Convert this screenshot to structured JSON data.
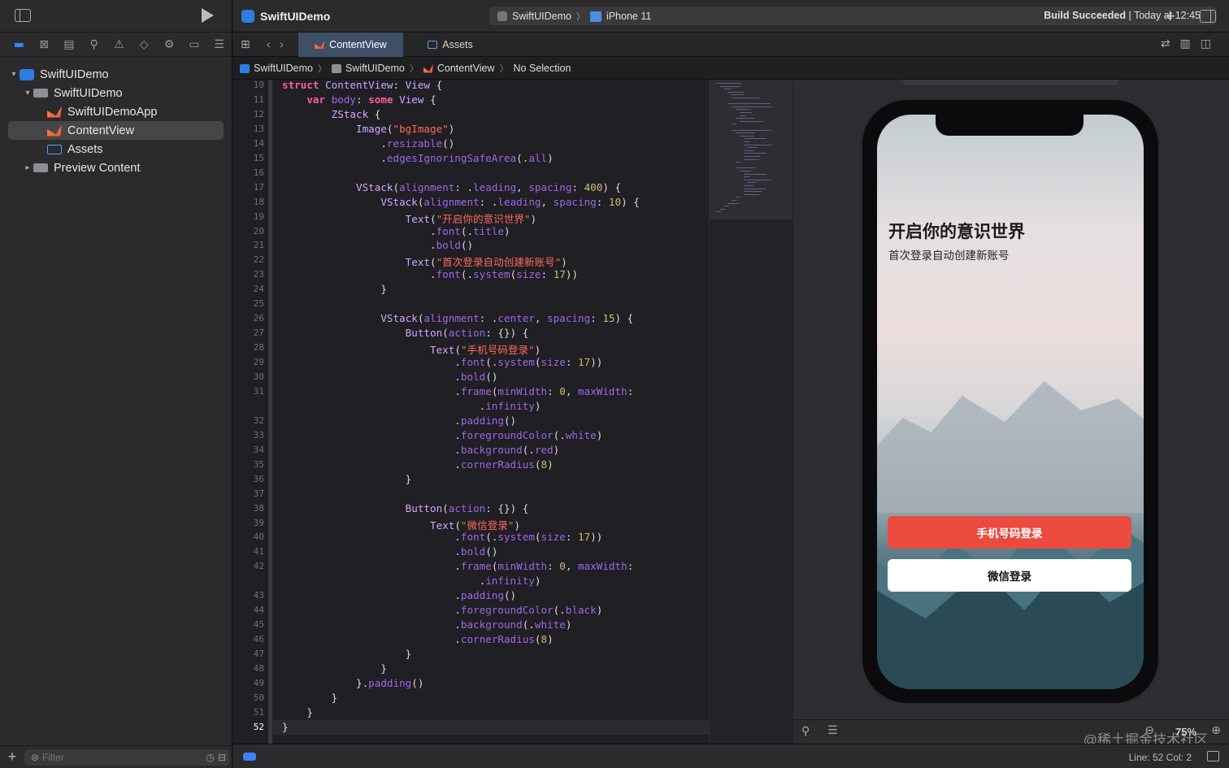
{
  "navigator": {
    "tree": [
      {
        "label": "SwiftUIDemo",
        "kind": "project",
        "disclosure": "open",
        "depth": 0
      },
      {
        "label": "SwiftUIDemo",
        "kind": "folder",
        "disclosure": "open",
        "depth": 1
      },
      {
        "label": "SwiftUIDemoApp",
        "kind": "swift",
        "disclosure": "",
        "depth": 2
      },
      {
        "label": "ContentView",
        "kind": "swift",
        "disclosure": "",
        "depth": 2,
        "selected": true
      },
      {
        "label": "Assets",
        "kind": "assets",
        "disclosure": "",
        "depth": 2
      },
      {
        "label": "Preview Content",
        "kind": "folder",
        "disclosure": "closed",
        "depth": 1
      }
    ],
    "filter_placeholder": "Filter"
  },
  "toolbar": {
    "project_title": "SwiftUIDemo",
    "scheme": "SwiftUIDemo",
    "device": "iPhone 11",
    "build_status_bold": "Build Succeeded",
    "build_status_time": "| Today at 12:45",
    "add_label": "+"
  },
  "tabs": [
    {
      "label": "ContentView",
      "active": true
    },
    {
      "label": "Assets",
      "active": false
    }
  ],
  "jumpbar": {
    "crumbs": [
      "SwiftUIDemo",
      "SwiftUIDemo",
      "ContentView",
      "No Selection"
    ]
  },
  "editor": {
    "current_line": 52,
    "lines": [
      {
        "n": "10",
        "html": "<span class='kw'>struct</span> <span class='ty'>ContentView</span>: <span class='ty'>View</span> {"
      },
      {
        "n": "11",
        "html": "    <span class='kw'>var</span> <span class='fn'>body</span>: <span class='kw'>some</span> <span class='ty'>View</span> {"
      },
      {
        "n": "12",
        "html": "        <span class='ty'>ZStack</span> {"
      },
      {
        "n": "13",
        "html": "            <span class='ty'>Image</span>(<span class='st'>\"bgImage\"</span>)"
      },
      {
        "n": "14",
        "html": "                .<span class='pr'>resizable</span>()"
      },
      {
        "n": "15",
        "html": "                .<span class='pr'>edgesIgnoringSafeArea</span>(.<span class='pr'>all</span>)"
      },
      {
        "n": "16",
        "html": ""
      },
      {
        "n": "17",
        "html": "            <span class='ty'>VStack</span>(<span class='pr'>alignment</span>: .<span class='pr'>leading</span>, <span class='pr'>spacing</span>: <span class='nu'>400</span>) {"
      },
      {
        "n": "18",
        "html": "                <span class='ty'>VStack</span>(<span class='pr'>alignment</span>: .<span class='pr'>leading</span>, <span class='pr'>spacing</span>: <span class='nu'>10</span>) {"
      },
      {
        "n": "19",
        "html": "                    <span class='ty'>Text</span>(<span class='st'>\"开启你的意识世界\"</span>)"
      },
      {
        "n": "20",
        "html": "                        .<span class='pr'>font</span>(.<span class='pr'>title</span>)"
      },
      {
        "n": "21",
        "html": "                        .<span class='pr'>bold</span>()"
      },
      {
        "n": "22",
        "html": "                    <span class='ty'>Text</span>(<span class='st'>\"首次登录自动创建新账号\"</span>)"
      },
      {
        "n": "23",
        "html": "                        .<span class='pr'>font</span>(.<span class='pr'>system</span>(<span class='pr'>size</span>: <span class='nu'>17</span>))"
      },
      {
        "n": "24",
        "html": "                }"
      },
      {
        "n": "25",
        "html": ""
      },
      {
        "n": "26",
        "html": "                <span class='ty'>VStack</span>(<span class='pr'>alignment</span>: .<span class='pr'>center</span>, <span class='pr'>spacing</span>: <span class='nu'>15</span>) {"
      },
      {
        "n": "27",
        "html": "                    <span class='ty'>Button</span>(<span class='pr'>action</span>: {}) {"
      },
      {
        "n": "28",
        "html": "                        <span class='ty'>Text</span>(<span class='st'>\"手机号码登录\"</span>)"
      },
      {
        "n": "29",
        "html": "                            .<span class='pr'>font</span>(.<span class='pr'>system</span>(<span class='pr'>size</span>: <span class='nu'>17</span>))"
      },
      {
        "n": "30",
        "html": "                            .<span class='pr'>bold</span>()"
      },
      {
        "n": "31",
        "html": "                            .<span class='pr'>frame</span>(<span class='pr'>minWidth</span>: <span class='nu'>0</span>, <span class='pr'>maxWidth</span>:"
      },
      {
        "n": "",
        "html": "                                .<span class='pr'>infinity</span>)"
      },
      {
        "n": "32",
        "html": "                            .<span class='pr'>padding</span>()"
      },
      {
        "n": "33",
        "html": "                            .<span class='pr'>foregroundColor</span>(.<span class='pr'>white</span>)"
      },
      {
        "n": "34",
        "html": "                            .<span class='pr'>background</span>(.<span class='pr'>red</span>)"
      },
      {
        "n": "35",
        "html": "                            .<span class='pr'>cornerRadius</span>(<span class='nu'>8</span>)"
      },
      {
        "n": "36",
        "html": "                    }"
      },
      {
        "n": "37",
        "html": ""
      },
      {
        "n": "38",
        "html": "                    <span class='ty'>Button</span>(<span class='pr'>action</span>: {}) {"
      },
      {
        "n": "39",
        "html": "                        <span class='ty'>Text</span>(<span class='st'>\"微信登录\"</span>)"
      },
      {
        "n": "40",
        "html": "                            .<span class='pr'>font</span>(.<span class='pr'>system</span>(<span class='pr'>size</span>: <span class='nu'>17</span>))"
      },
      {
        "n": "41",
        "html": "                            .<span class='pr'>bold</span>()"
      },
      {
        "n": "42",
        "html": "                            .<span class='pr'>frame</span>(<span class='pr'>minWidth</span>: <span class='nu'>0</span>, <span class='pr'>maxWidth</span>:"
      },
      {
        "n": "",
        "html": "                                .<span class='pr'>infinity</span>)"
      },
      {
        "n": "43",
        "html": "                            .<span class='pr'>padding</span>()"
      },
      {
        "n": "44",
        "html": "                            .<span class='pr'>foregroundColor</span>(.<span class='pr'>black</span>)"
      },
      {
        "n": "45",
        "html": "                            .<span class='pr'>background</span>(.<span class='pr'>white</span>)"
      },
      {
        "n": "46",
        "html": "                            .<span class='pr'>cornerRadius</span>(<span class='nu'>8</span>)"
      },
      {
        "n": "47",
        "html": "                    }"
      },
      {
        "n": "48",
        "html": "                }"
      },
      {
        "n": "49",
        "html": "            }.<span class='pr'>padding</span>()"
      },
      {
        "n": "50",
        "html": "        }"
      },
      {
        "n": "51",
        "html": "    }"
      },
      {
        "n": "52",
        "html": "}"
      }
    ]
  },
  "preview": {
    "title": "开启你的意识世界",
    "subtitle": "首次登录自动创建新账号",
    "phone_login_button": "手机号码登录",
    "wechat_login_button": "微信登录",
    "zoom": "75%",
    "watermark": "@稀土掘金技术社区",
    "colors": {
      "phone_button_bg": "#ea4b3e",
      "wechat_button_bg": "#ffffff"
    }
  },
  "statusbar": {
    "position": "Line: 52  Col: 2"
  },
  "colors": {
    "accent": "#3b82f6",
    "active_tab": "#3f4f68"
  }
}
